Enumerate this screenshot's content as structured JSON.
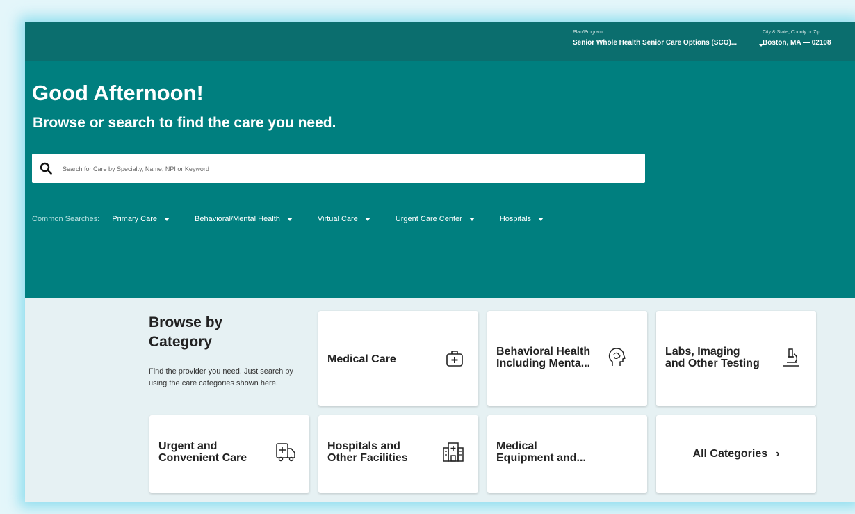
{
  "header": {
    "plan_label": "Plan/Program",
    "plan_value": "Senior Whole Health Senior Care Options (SCO)...",
    "location_label": "City & State, County or Zip",
    "location_value": "Boston, MA — 02108"
  },
  "hero": {
    "greeting": "Good Afternoon!",
    "subtitle": "Browse or search to find the care you need.",
    "search_placeholder": "Search for Care by Specialty, Name, NPI or Keyword",
    "common_label": "Common Searches:",
    "common_searches": [
      "Primary Care",
      "Behavioral/Mental Health",
      "Virtual Care",
      "Urgent Care Center",
      "Hospitals"
    ]
  },
  "browse": {
    "title": "Browse by Category",
    "description": "Find the provider you need. Just search by using the care categories shown here.",
    "categories": [
      {
        "line1": "Medical Care",
        "line2": "",
        "icon": "first-aid-kit-icon"
      },
      {
        "line1": "Behavioral Health",
        "line2": "Including Menta...",
        "icon": "head-brain-icon"
      },
      {
        "line1": "Labs, Imaging",
        "line2": "and Other Testing",
        "icon": "microscope-icon"
      },
      {
        "line1": "Urgent and",
        "line2": "Convenient Care",
        "icon": "ambulance-icon"
      },
      {
        "line1": "Hospitals and",
        "line2": "Other Facilities",
        "icon": "hospital-building-icon"
      },
      {
        "line1": "Medical",
        "line2": "Equipment and...",
        "icon": ""
      }
    ],
    "all_categories": "All Categories"
  },
  "colors": {
    "topbar": "#0b6e6e",
    "hero": "#007f7f",
    "content_bg": "#e6f1f3"
  }
}
